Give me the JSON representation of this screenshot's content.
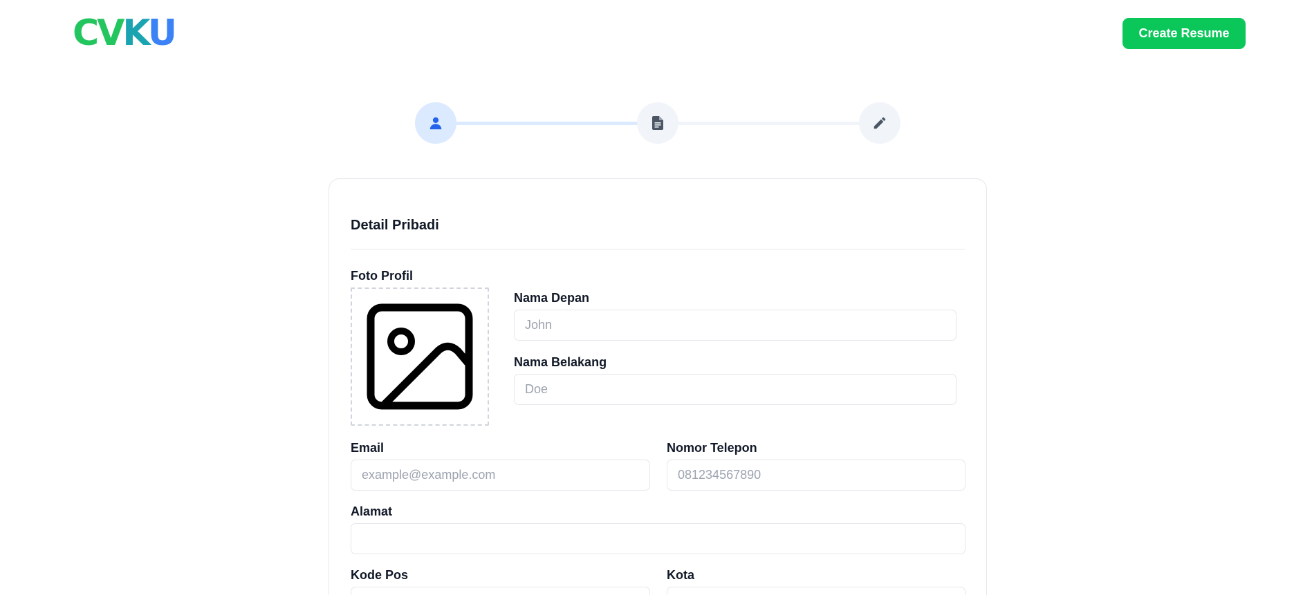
{
  "header": {
    "logo": {
      "part1": "CV",
      "part2": "K",
      "part3": "U"
    },
    "create_button": "Create Resume"
  },
  "stepper": {
    "steps": [
      {
        "icon": "user-icon",
        "active": true
      },
      {
        "icon": "document-icon",
        "active": false
      },
      {
        "icon": "pencil-icon",
        "active": false
      }
    ]
  },
  "form": {
    "title": "Detail Pribadi",
    "photo_label": "Foto Profil",
    "photo_icon": "image-placeholder-icon",
    "first_name": {
      "label": "Nama Depan",
      "placeholder": "John",
      "value": ""
    },
    "last_name": {
      "label": "Nama Belakang",
      "placeholder": "Doe",
      "value": ""
    },
    "email": {
      "label": "Email",
      "placeholder": "example@example.com",
      "value": ""
    },
    "phone": {
      "label": "Nomor Telepon",
      "placeholder": "081234567890",
      "value": ""
    },
    "address": {
      "label": "Alamat",
      "placeholder": "",
      "value": ""
    },
    "postal_code": {
      "label": "Kode Pos",
      "placeholder": "",
      "value": ""
    },
    "city": {
      "label": "Kota",
      "placeholder": "",
      "value": ""
    }
  },
  "colors": {
    "brand_green": "#0bc75a",
    "logo_green": "#22c55e",
    "logo_blue": "#3b82f6",
    "step_active_bg": "#dbeafe",
    "step_active_icon": "#2563eb",
    "step_inactive_bg": "#f1f5f9",
    "step_inactive_icon": "#4b5563"
  }
}
